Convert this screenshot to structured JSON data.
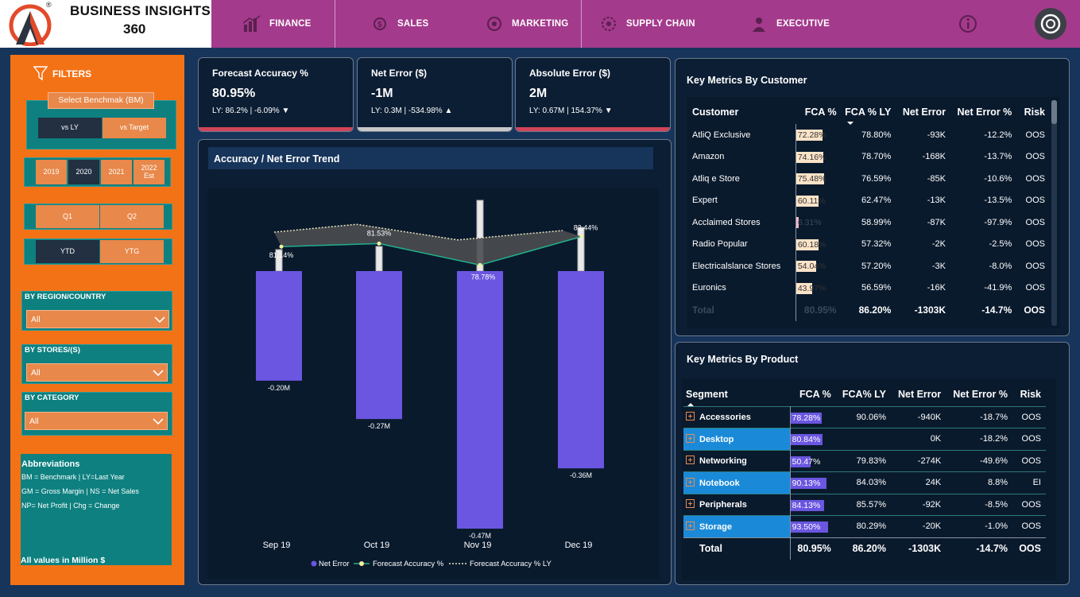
{
  "brand": {
    "line1": "BUSINESS INSIGHTS",
    "line2": "360",
    "logo_registered": "®"
  },
  "nav": [
    {
      "label": "FINANCE",
      "icon": "finance-chart-icon"
    },
    {
      "label": "SALES",
      "icon": "sales-icon"
    },
    {
      "label": "MARKETING",
      "icon": "marketing-icon"
    },
    {
      "label": "SUPPLY CHAIN",
      "icon": "supply-chain-icon"
    },
    {
      "label": "EXECUTIVE",
      "icon": "executive-icon"
    }
  ],
  "filters": {
    "title": "FILTERS",
    "benchmark_label": "Select Benchmak (BM)",
    "vs_ly": "vs LY",
    "vs_target": "vs Target",
    "years": [
      "2019",
      "2020",
      "2021",
      "2022 Est"
    ],
    "quarters": [
      "Q1",
      "Q2"
    ],
    "ytd": "YTD",
    "ytg": "YTG",
    "region_label": "BY REGION/COUNTRY",
    "region_value": "All",
    "stores_label": "BY STORES/(S)",
    "stores_value": "All",
    "category_label": "BY CATEGORY",
    "category_value": "All",
    "abbrev_title": "Abbreviations",
    "abbrev_lines": [
      "BM = Benchmark | LY=Last Year",
      "GM = Gross Margin | NS = Net Sales",
      "NP= Net Profit | Chg = Change"
    ],
    "units_note": "All values in Million $"
  },
  "kpis": [
    {
      "title": "Forecast Accuracy %",
      "value": "80.95%",
      "sub": "LY: 86.2% | -6.09%",
      "arrow": "▼",
      "bar_color": "#d0455a"
    },
    {
      "title": "Net Error ($)",
      "value": "-1M",
      "sub": "LY: 0.3M | -534.98%",
      "arrow": "▲",
      "bar_color": "#c8c8c8"
    },
    {
      "title": "Absolute Error ($)",
      "value": "2M",
      "sub": "LY: 0.67M | 154.37%",
      "arrow": "▼",
      "bar_color": "#d0455a"
    }
  ],
  "chart_data": {
    "type": "bar",
    "title": "Accuracy / Net Error Trend",
    "categories": [
      "Sep 19",
      "Oct 19",
      "Nov 19",
      "Dec 19"
    ],
    "series": [
      {
        "name": "Net Error",
        "type": "bar",
        "values": [
          -0.2,
          -0.27,
          -0.47,
          -0.36
        ],
        "labels": [
          "-0.20M",
          "-0.27M",
          "-0.47M",
          "-0.36M"
        ],
        "color": "#6a56e0"
      },
      {
        "name": "Forecast Accuracy %",
        "type": "line",
        "values": [
          81.14,
          81.53,
          78.78,
          82.44
        ],
        "labels": [
          "81.14%",
          "81.53%",
          "78.78%",
          "82.44%"
        ],
        "color": "#22b08c"
      },
      {
        "name": "Forecast Accuracy % LY",
        "type": "line",
        "values": [
          83.0,
          84.0,
          82.0,
          83.2
        ],
        "color": "#e8e8c0"
      }
    ],
    "legend_position": "bottom-center"
  },
  "customer_table": {
    "title": "Key Metrics By Customer",
    "columns": [
      "Customer",
      "FCA %",
      "FCA % LY",
      "Net Error",
      "Net Error %",
      "Risk"
    ],
    "rows": [
      {
        "name": "AtliQ Exclusive",
        "fca": "72.28%",
        "fca_val": 72.28,
        "fca_ly": "78.80%",
        "ne": "-93K",
        "nep": "-12.2%",
        "risk": "OOS"
      },
      {
        "name": "Amazon",
        "fca": "74.16%",
        "fca_val": 74.16,
        "fca_ly": "78.70%",
        "ne": "-168K",
        "nep": "-13.7%",
        "risk": "OOS"
      },
      {
        "name": "Atliq e Store",
        "fca": "75.48%",
        "fca_val": 75.48,
        "fca_ly": "76.59%",
        "ne": "-85K",
        "nep": "-10.6%",
        "risk": "OOS"
      },
      {
        "name": "Expert",
        "fca": "60.11%",
        "fca_val": 60.11,
        "fca_ly": "62.47%",
        "ne": "-13K",
        "nep": "-13.5%",
        "risk": "OOS"
      },
      {
        "name": "Acclaimed Stores",
        "fca": "6.31%",
        "fca_val": 6.31,
        "fca_ly": "58.99%",
        "ne": "-87K",
        "nep": "-97.9%",
        "risk": "OOS"
      },
      {
        "name": "Radio Popular",
        "fca": "60.18%",
        "fca_val": 60.18,
        "fca_ly": "57.32%",
        "ne": "-2K",
        "nep": "-2.5%",
        "risk": "OOS"
      },
      {
        "name": "Electricalslance Stores",
        "fca": "54.04%",
        "fca_val": 54.04,
        "fca_ly": "57.20%",
        "ne": "-3K",
        "nep": "-8.0%",
        "risk": "OOS"
      },
      {
        "name": "Euronics",
        "fca": "43.97%",
        "fca_val": 43.97,
        "fca_ly": "56.59%",
        "ne": "-16K",
        "nep": "-41.9%",
        "risk": "OOS"
      }
    ],
    "total": {
      "name": "Total",
      "fca": "80.95%",
      "fca_ly": "86.20%",
      "ne": "-1303K",
      "nep": "-14.7%",
      "risk": "OOS"
    }
  },
  "product_table": {
    "title": "Key Metrics By Product",
    "columns": [
      "Segment",
      "FCA %",
      "FCA% LY",
      "Net Error",
      "Net Error %",
      "Risk"
    ],
    "rows": [
      {
        "name": "Accessories",
        "fca": "78.28%",
        "fca_val": 78.28,
        "fca_ly": "90.06%",
        "ne": "-940K",
        "nep": "-18.7%",
        "risk": "OOS",
        "highlight": false
      },
      {
        "name": "Desktop",
        "fca": "80.84%",
        "fca_val": 80.84,
        "fca_ly": "",
        "ne": "0K",
        "nep": "-18.2%",
        "risk": "OOS",
        "highlight": true
      },
      {
        "name": "Networking",
        "fca": "50.47%",
        "fca_val": 50.47,
        "fca_ly": "79.83%",
        "ne": "-274K",
        "nep": "-49.6%",
        "risk": "OOS",
        "highlight": false
      },
      {
        "name": "Notebook",
        "fca": "90.13%",
        "fca_val": 90.13,
        "fca_ly": "84.03%",
        "ne": "24K",
        "nep": "8.8%",
        "risk": "EI",
        "highlight": true
      },
      {
        "name": "Peripherals",
        "fca": "84.13%",
        "fca_val": 84.13,
        "fca_ly": "85.57%",
        "ne": "-92K",
        "nep": "-8.5%",
        "risk": "OOS",
        "highlight": false
      },
      {
        "name": "Storage",
        "fca": "93.50%",
        "fca_val": 93.5,
        "fca_ly": "80.29%",
        "ne": "-20K",
        "nep": "-1.0%",
        "risk": "OOS",
        "highlight": true
      }
    ],
    "total": {
      "name": "Total",
      "fca": "80.95%",
      "fca_ly": "86.20%",
      "ne": "-1303K",
      "nep": "-14.7%",
      "risk": "OOS"
    }
  }
}
